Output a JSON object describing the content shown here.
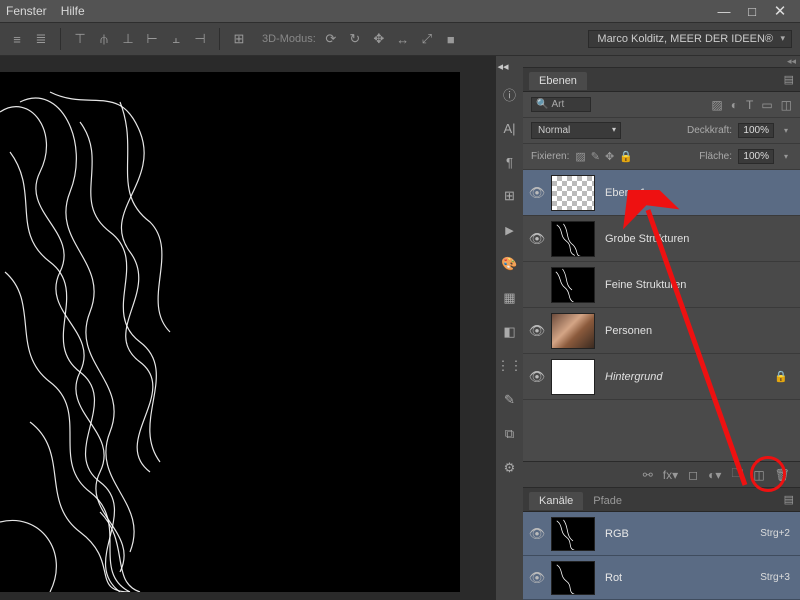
{
  "menu": {
    "fenster": "Fenster",
    "hilfe": "Hilfe"
  },
  "window_controls": {
    "min": "—",
    "max": "□",
    "close": "✕"
  },
  "toolbar": {
    "mode3d_label": "3D-Modus:",
    "workspace": "Marco Kolditz, MEER DER IDEEN®"
  },
  "layers_panel": {
    "title": "Ebenen",
    "search_label": "Art",
    "blend_mode": "Normal",
    "opacity_label": "Deckkraft:",
    "opacity_value": "100%",
    "lock_label": "Fixieren:",
    "fill_label": "Fläche:",
    "fill_value": "100%",
    "layers": [
      {
        "name": "Ebene 1",
        "visible": true,
        "selected": true,
        "thumb": "checker"
      },
      {
        "name": "Grobe Strukturen",
        "visible": true,
        "thumb": "scribble"
      },
      {
        "name": "Feine Strukturen",
        "visible": false,
        "thumb": "scribble"
      },
      {
        "name": "Personen",
        "visible": true,
        "thumb": "photo"
      },
      {
        "name": "Hintergrund",
        "visible": true,
        "thumb": "white",
        "locked": true,
        "italic": true
      }
    ]
  },
  "channels_panel": {
    "tab1": "Kanäle",
    "tab2": "Pfade",
    "channels": [
      {
        "name": "RGB",
        "shortcut": "Strg+2",
        "visible": true
      },
      {
        "name": "Rot",
        "shortcut": "Strg+3",
        "visible": true
      }
    ]
  },
  "icons": {
    "eye": "👁",
    "lock": "🔒",
    "search": "🔍"
  }
}
